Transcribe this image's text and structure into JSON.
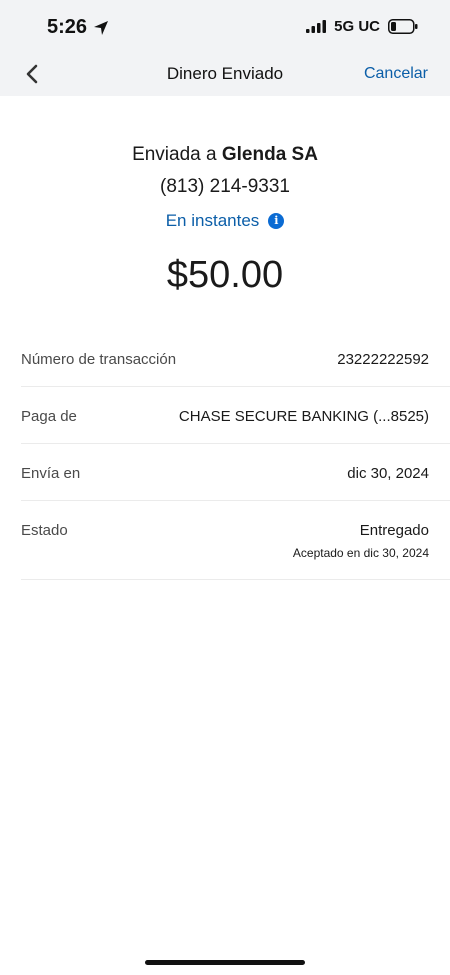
{
  "status_bar": {
    "time": "5:26",
    "network": "5G UC",
    "location_icon": "location-arrow-icon",
    "signal_icon": "signal-bars-icon",
    "battery_icon": "battery-low-icon"
  },
  "nav": {
    "back_icon": "chevron-left-icon",
    "title": "Dinero Enviado",
    "cancel_label": "Cancelar"
  },
  "header": {
    "sent_to_prefix": "Enviada a",
    "recipient_name": "Glenda SA",
    "phone": "(813) 214-9331",
    "speed_label": "En instantes",
    "info_icon": "info-icon",
    "amount": "$50.00"
  },
  "details": {
    "rows": [
      {
        "label": "Número de transacción",
        "value": "23222222592"
      },
      {
        "label": "Paga de",
        "value": "CHASE SECURE BANKING (...8525)"
      },
      {
        "label": "Envía en",
        "value": "dic 30, 2024"
      },
      {
        "label": "Estado",
        "value": "Entregado",
        "sub": "Aceptado en dic 30, 2024"
      }
    ]
  },
  "colors": {
    "accent": "#0b5ea8",
    "header_bg": "#f2f3f5",
    "divider": "#ebebeb"
  }
}
